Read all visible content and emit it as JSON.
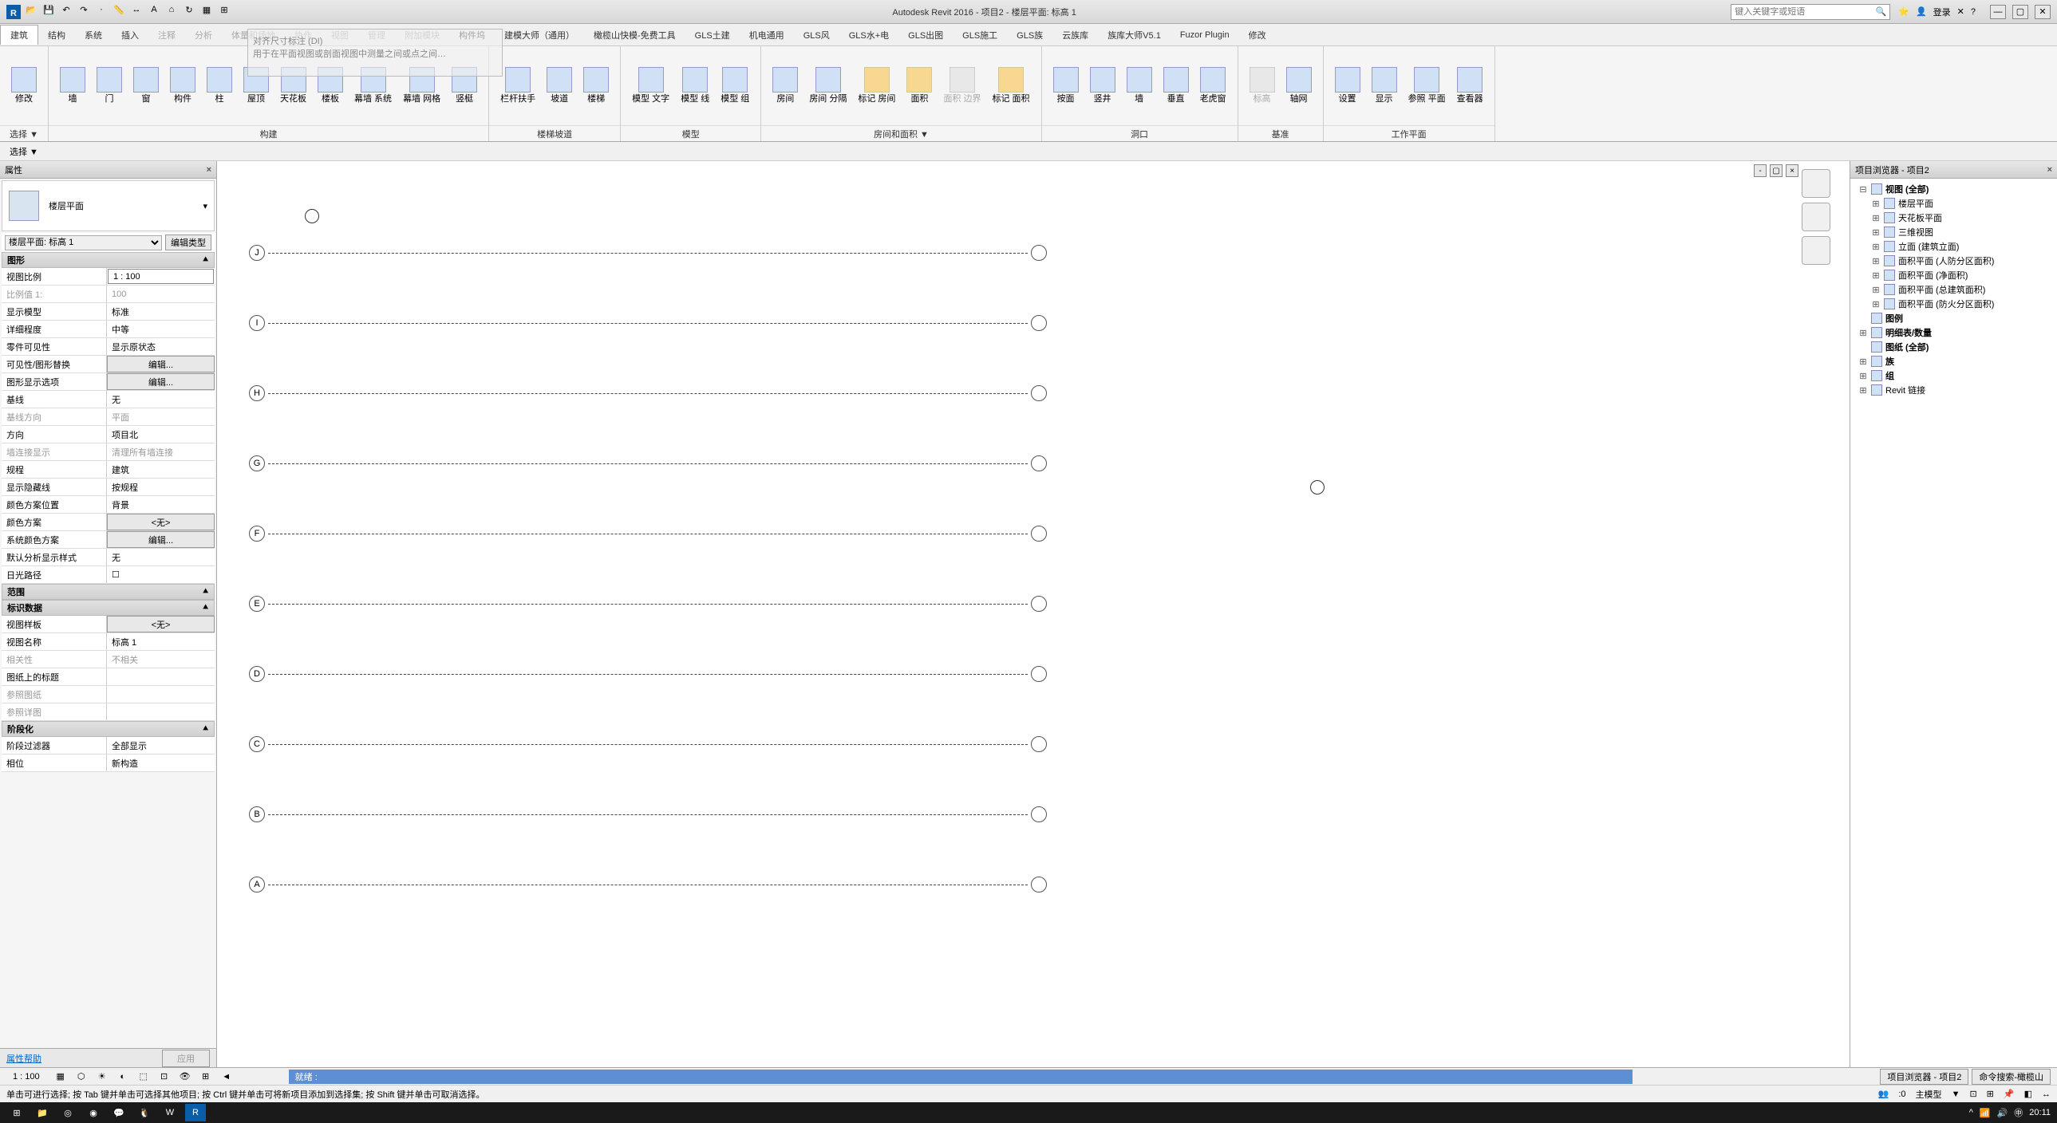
{
  "titlebar": {
    "app_title": "Autodesk Revit 2016  -  项目2 - 楼层平面: 标高 1",
    "search_placeholder": "键入关键字或短语",
    "login_label": "登录"
  },
  "menubar": {
    "tabs": [
      "建筑",
      "结构",
      "系统",
      "插入",
      "注释",
      "分析",
      "体量和场地",
      "协作",
      "视图",
      "管理",
      "附加模块",
      "构件坞",
      "建模大师（通用）",
      "橄榄山快模-免费工具",
      "GLS土建",
      "机电通用",
      "GLS风",
      "GLS水+电",
      "GLS出图",
      "GLS施工",
      "GLS族",
      "云族库",
      "族库大师V5.1",
      "Fuzor Plugin",
      "修改"
    ],
    "active_index": 0
  },
  "ribbon": {
    "groups": [
      {
        "label": "选择 ▼",
        "items": [
          {
            "label": "修改",
            "k": "modify"
          }
        ]
      },
      {
        "label": "构建",
        "items": [
          {
            "label": "墙",
            "k": "wall"
          },
          {
            "label": "门",
            "k": "door"
          },
          {
            "label": "窗",
            "k": "window"
          },
          {
            "label": "构件",
            "k": "component"
          },
          {
            "label": "柱",
            "k": "column"
          },
          {
            "label": "屋顶",
            "k": "roof"
          },
          {
            "label": "天花板",
            "k": "ceiling"
          },
          {
            "label": "楼板",
            "k": "floor"
          },
          {
            "label": "幕墙 系统",
            "k": "curtain-system"
          },
          {
            "label": "幕墙 网格",
            "k": "curtain-grid"
          },
          {
            "label": "竖梃",
            "k": "mullion"
          }
        ]
      },
      {
        "label": "楼梯坡道",
        "items": [
          {
            "label": "栏杆扶手",
            "k": "railing"
          },
          {
            "label": "坡道",
            "k": "ramp"
          },
          {
            "label": "楼梯",
            "k": "stair"
          }
        ]
      },
      {
        "label": "模型",
        "items": [
          {
            "label": "模型 文字",
            "k": "model-text"
          },
          {
            "label": "模型 线",
            "k": "model-line"
          },
          {
            "label": "模型 组",
            "k": "model-group"
          }
        ]
      },
      {
        "label": "房间和面积 ▼",
        "items": [
          {
            "label": "房间",
            "k": "room"
          },
          {
            "label": "房间 分隔",
            "k": "room-sep"
          },
          {
            "label": "标记 房间",
            "k": "tag-room"
          },
          {
            "label": "面积",
            "k": "area"
          },
          {
            "label": "面积 边界",
            "k": "area-bound",
            "disabled": true
          },
          {
            "label": "标记 面积",
            "k": "tag-area"
          }
        ]
      },
      {
        "label": "洞口",
        "items": [
          {
            "label": "按面",
            "k": "by-face"
          },
          {
            "label": "竖井",
            "k": "shaft"
          },
          {
            "label": "墙",
            "k": "wall-open"
          },
          {
            "label": "垂直",
            "k": "vertical"
          },
          {
            "label": "老虎窗",
            "k": "dormer"
          }
        ]
      },
      {
        "label": "基准",
        "items": [
          {
            "label": "标高",
            "k": "level",
            "disabled": true
          },
          {
            "label": "轴网",
            "k": "grid"
          }
        ]
      },
      {
        "label": "工作平面",
        "items": [
          {
            "label": "设置",
            "k": "set"
          },
          {
            "label": "显示",
            "k": "show"
          },
          {
            "label": "参照 平面",
            "k": "ref-plane"
          },
          {
            "label": "查看器",
            "k": "viewer"
          }
        ]
      }
    ]
  },
  "ghost": {
    "title": "对齐尺寸标注 (DI)",
    "desc": "用于在平面视图或剖面视图中测量之间或点之间…"
  },
  "props": {
    "panel_title": "属性",
    "type_name": "楼层平面",
    "type_dropdown": "楼层平面: 标高 1",
    "edit_type_btn": "编辑类型",
    "sections": [
      {
        "name": "图形",
        "rows": [
          {
            "k": "视图比例",
            "v": "1 : 100",
            "input": true
          },
          {
            "k": "比例值 1:",
            "v": "100",
            "dim": true
          },
          {
            "k": "显示模型",
            "v": "标准"
          },
          {
            "k": "详细程度",
            "v": "中等"
          },
          {
            "k": "零件可见性",
            "v": "显示原状态"
          },
          {
            "k": "可见性/图形替换",
            "v": "编辑...",
            "btn": true
          },
          {
            "k": "图形显示选项",
            "v": "编辑...",
            "btn": true
          },
          {
            "k": "基线",
            "v": "无"
          },
          {
            "k": "基线方向",
            "v": "平面",
            "dim": true
          },
          {
            "k": "方向",
            "v": "项目北"
          },
          {
            "k": "墙连接显示",
            "v": "清理所有墙连接",
            "dim": true
          },
          {
            "k": "规程",
            "v": "建筑"
          },
          {
            "k": "显示隐藏线",
            "v": "按规程"
          },
          {
            "k": "颜色方案位置",
            "v": "背景"
          },
          {
            "k": "颜色方案",
            "v": "<无>",
            "btn": true
          },
          {
            "k": "系统颜色方案",
            "v": "编辑...",
            "btn": true
          },
          {
            "k": "默认分析显示样式",
            "v": "无"
          },
          {
            "k": "日光路径",
            "v": "☐"
          }
        ]
      },
      {
        "name": "范围",
        "rows": []
      },
      {
        "name": "标识数据",
        "rows": [
          {
            "k": "视图样板",
            "v": "<无>",
            "btn": true
          },
          {
            "k": "视图名称",
            "v": "标高 1"
          },
          {
            "k": "相关性",
            "v": "不相关",
            "dim": true
          },
          {
            "k": "图纸上的标题",
            "v": ""
          },
          {
            "k": "参照图纸",
            "v": "",
            "dim": true
          },
          {
            "k": "参照详图",
            "v": "",
            "dim": true
          }
        ]
      },
      {
        "name": "阶段化",
        "rows": [
          {
            "k": "阶段过滤器",
            "v": "全部显示"
          },
          {
            "k": "相位",
            "v": "新构造"
          }
        ]
      }
    ],
    "help_label": "属性帮助",
    "apply_label": "应用"
  },
  "drawing": {
    "grid_labels": [
      "J",
      "I",
      "H",
      "G",
      "F",
      "E",
      "D",
      "C",
      "B",
      "A"
    ]
  },
  "browser": {
    "panel_title": "项目浏览器 - 项目2",
    "tree": [
      {
        "lvl": 1,
        "exp": "⊟",
        "bold": true,
        "lbl": "视图 (全部)"
      },
      {
        "lvl": 2,
        "exp": "⊞",
        "lbl": "楼层平面"
      },
      {
        "lvl": 2,
        "exp": "⊞",
        "lbl": "天花板平面"
      },
      {
        "lvl": 2,
        "exp": "⊞",
        "lbl": "三维视图"
      },
      {
        "lvl": 2,
        "exp": "⊞",
        "lbl": "立面 (建筑立面)"
      },
      {
        "lvl": 2,
        "exp": "⊞",
        "lbl": "面积平面 (人防分区面积)"
      },
      {
        "lvl": 2,
        "exp": "⊞",
        "lbl": "面积平面 (净面积)"
      },
      {
        "lvl": 2,
        "exp": "⊞",
        "lbl": "面积平面 (总建筑面积)"
      },
      {
        "lvl": 2,
        "exp": "⊞",
        "lbl": "面积平面 (防火分区面积)"
      },
      {
        "lvl": 1,
        "exp": "",
        "bold": true,
        "lbl": "图例"
      },
      {
        "lvl": 1,
        "exp": "⊞",
        "bold": true,
        "lbl": "明细表/数量"
      },
      {
        "lvl": 1,
        "exp": "",
        "bold": true,
        "lbl": "图纸 (全部)"
      },
      {
        "lvl": 1,
        "exp": "⊞",
        "bold": true,
        "lbl": "族"
      },
      {
        "lvl": 1,
        "exp": "⊞",
        "bold": true,
        "lbl": "组"
      },
      {
        "lvl": 1,
        "exp": "⊞",
        "bold": false,
        "lbl": "Revit 链接"
      }
    ]
  },
  "viewbar": {
    "scale": "1 : 100",
    "status": "就绪 :",
    "right_tabs": [
      "项目浏览器 - 项目2",
      "命令搜索-橄榄山"
    ]
  },
  "hint": {
    "text": "单击可进行选择; 按 Tab 键并单击可选择其他项目; 按 Ctrl 键并单击可将新项目添加到选择集; 按 Shift 键并单击可取消选择。",
    "coord": ":0",
    "model_label": "主模型"
  },
  "taskbar": {
    "time": "20:11"
  }
}
